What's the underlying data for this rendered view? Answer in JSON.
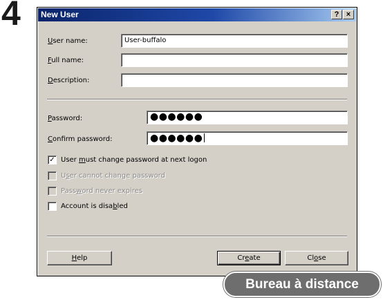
{
  "step": "4",
  "window": {
    "title": "New User",
    "help_btn": "?",
    "close_btn": "×"
  },
  "fields": {
    "username": {
      "label_pre": "",
      "label_key": "U",
      "label_post": "ser name:",
      "value": "User-buffalo"
    },
    "fullname": {
      "label_pre": "",
      "label_key": "F",
      "label_post": "ull name:",
      "value": ""
    },
    "description": {
      "label_pre": "",
      "label_key": "D",
      "label_post": "escription:",
      "value": ""
    },
    "password": {
      "label_pre": "",
      "label_key": "P",
      "label_post": "assword:",
      "value": "●●●●●●"
    },
    "confirm": {
      "label_pre": "",
      "label_key": "C",
      "label_post": "onfirm password:",
      "value": "●●●●●●"
    }
  },
  "options": [
    {
      "pre": "User ",
      "key": "m",
      "post": "ust change password at next logon",
      "checked": true,
      "enabled": true,
      "mark": "✓"
    },
    {
      "pre": "U",
      "key": "s",
      "post": "er cannot change password",
      "checked": false,
      "enabled": false,
      "mark": ""
    },
    {
      "pre": "Pass",
      "key": "w",
      "post": "ord never expires",
      "checked": false,
      "enabled": false,
      "mark": ""
    },
    {
      "pre": "Account is disa",
      "key": "b",
      "post": "led",
      "checked": false,
      "enabled": true,
      "mark": ""
    }
  ],
  "buttons": {
    "help": {
      "pre": "",
      "key": "H",
      "post": "elp"
    },
    "create": {
      "pre": "Cr",
      "key": "e",
      "post": "ate"
    },
    "close": {
      "pre": "Cl",
      "key": "o",
      "post": "se"
    }
  },
  "badge": "Bureau à distance"
}
